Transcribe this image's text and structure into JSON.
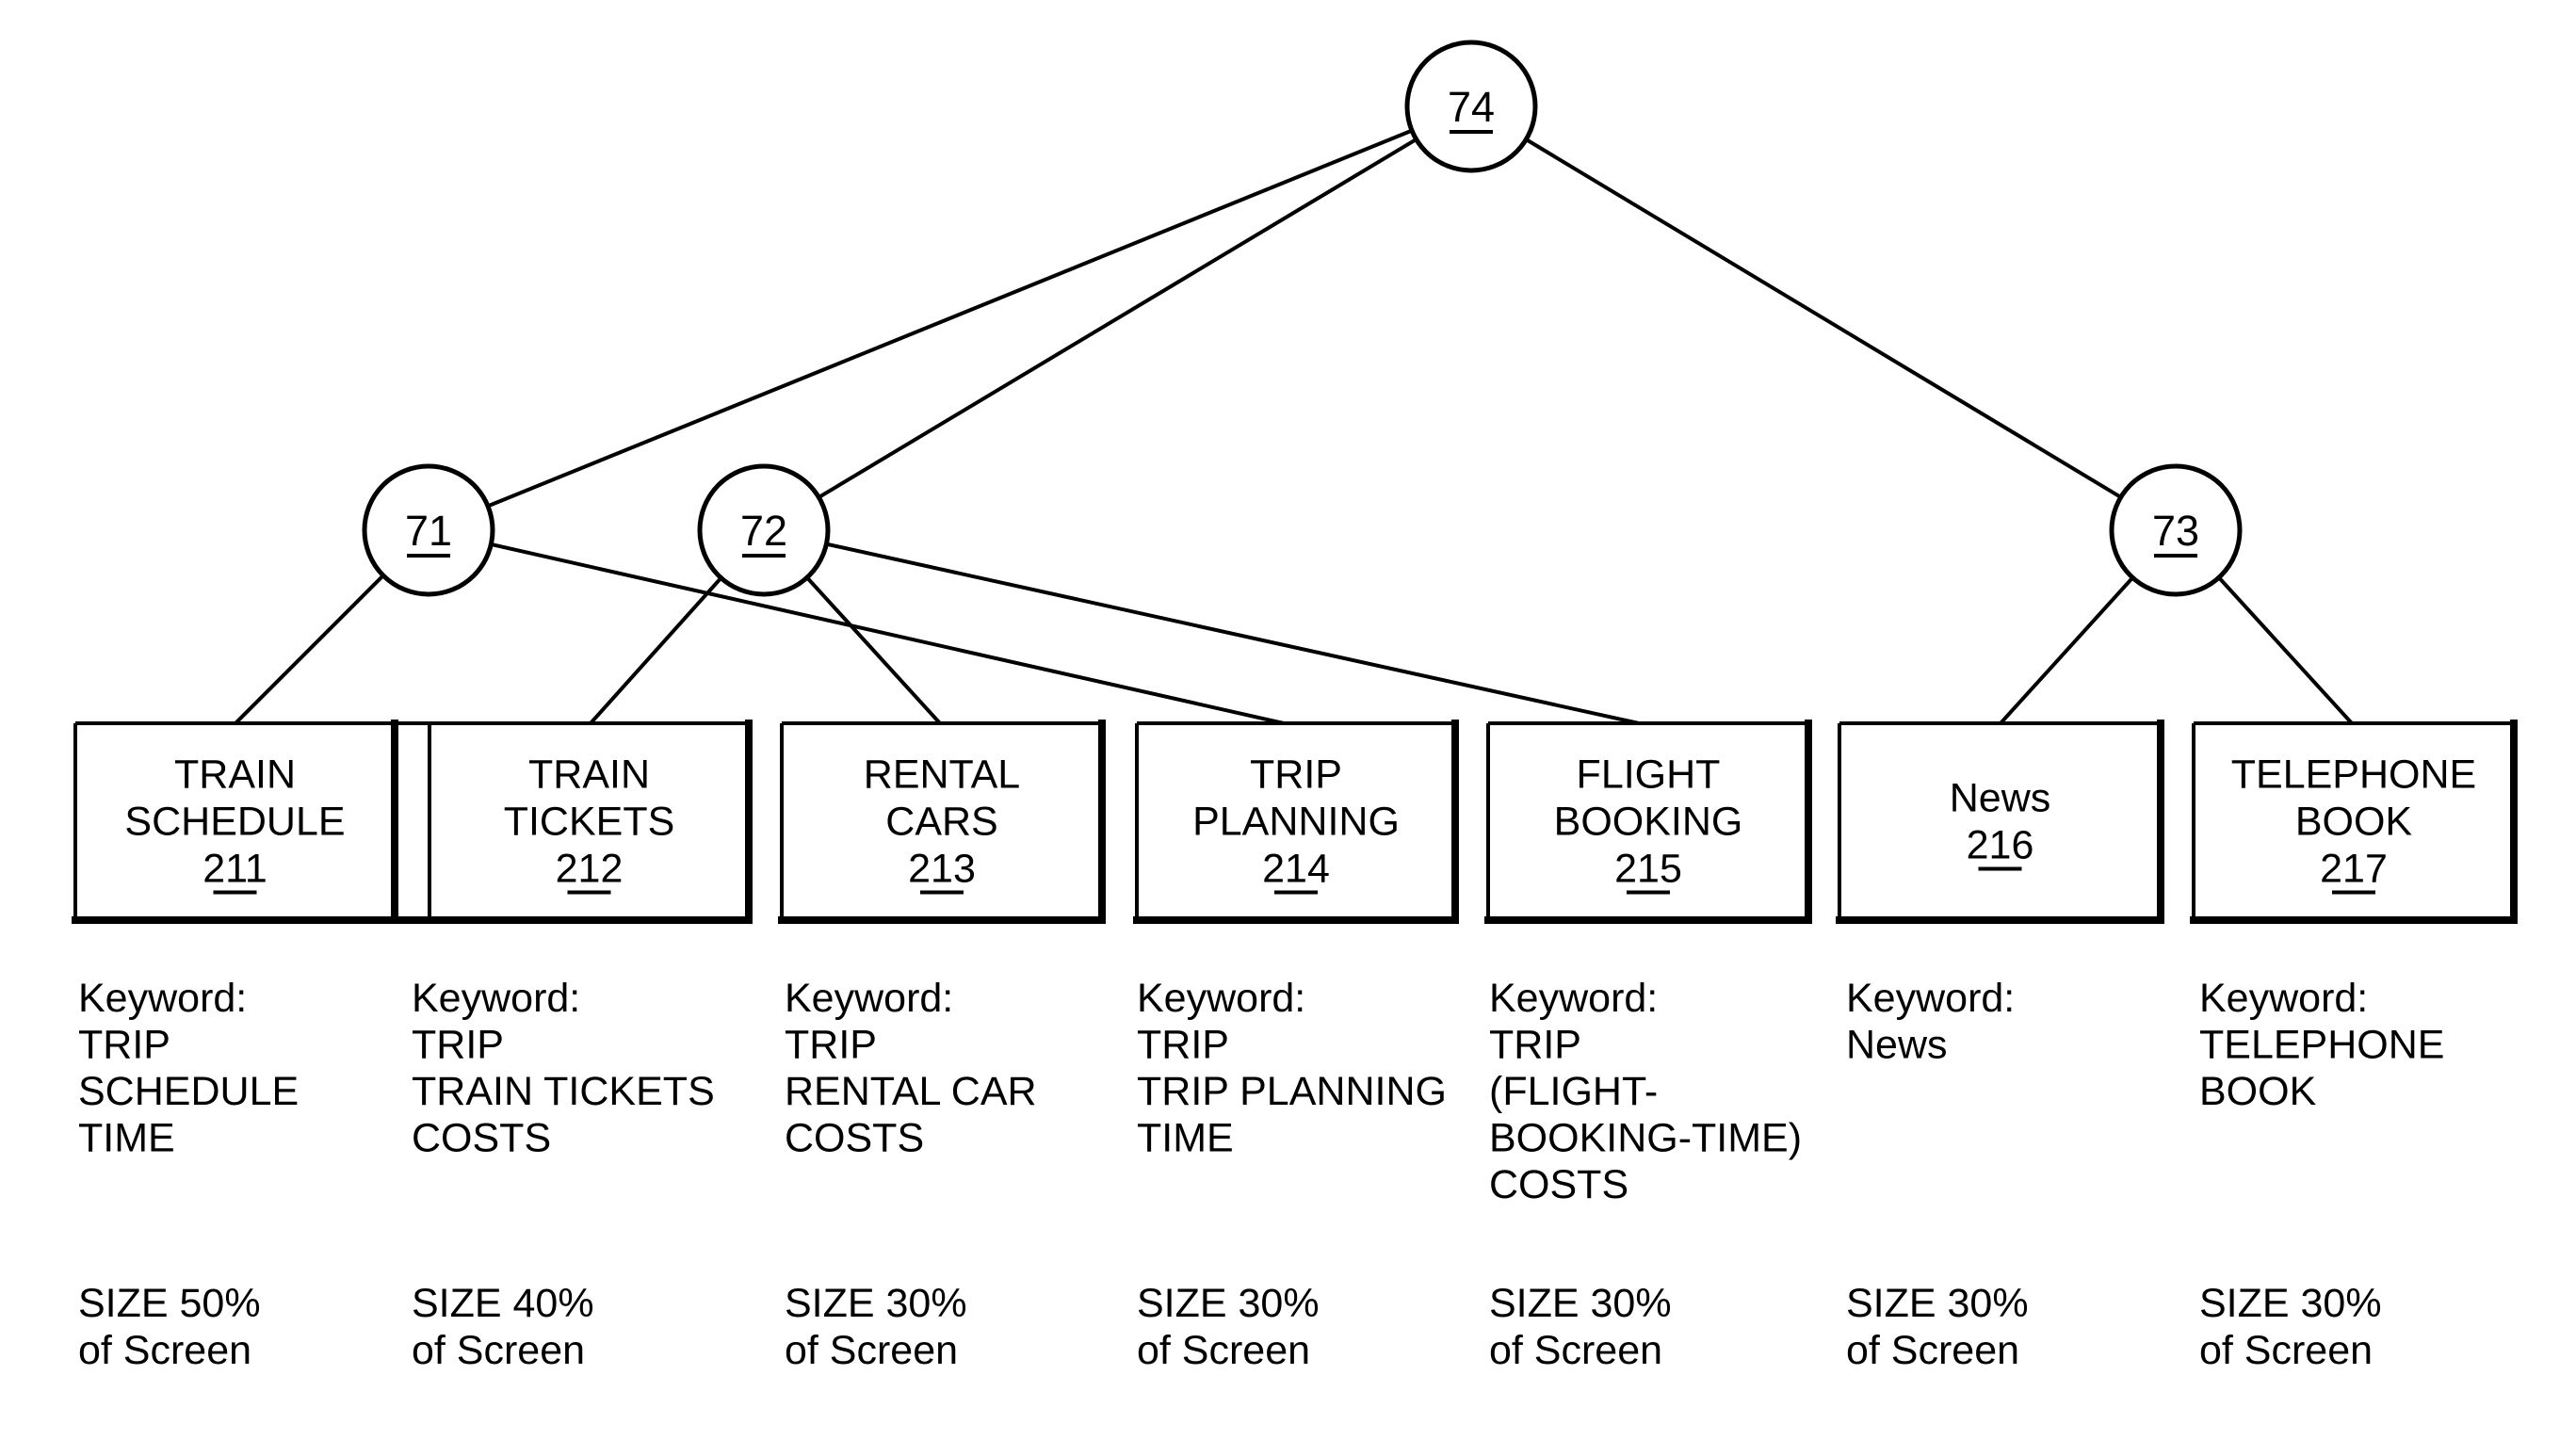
{
  "diagram": {
    "nodes": [
      {
        "id": "74",
        "label": "74",
        "level": "root"
      },
      {
        "id": "71",
        "label": "71",
        "level": "middle"
      },
      {
        "id": "72",
        "label": "72",
        "level": "middle"
      },
      {
        "id": "73",
        "label": "73",
        "level": "middle"
      }
    ],
    "edges": [
      {
        "from": "74",
        "to": "71"
      },
      {
        "from": "74",
        "to": "72"
      },
      {
        "from": "74",
        "to": "73"
      },
      {
        "from": "71",
        "to": "211"
      },
      {
        "from": "71",
        "to": "214"
      },
      {
        "from": "72",
        "to": "212"
      },
      {
        "from": "72",
        "to": "213"
      },
      {
        "from": "72",
        "to": "215"
      },
      {
        "from": "73",
        "to": "216"
      },
      {
        "from": "73",
        "to": "217"
      }
    ],
    "boxes": [
      {
        "id": "211",
        "lines": [
          "TRAIN",
          "SCHEDULE"
        ],
        "number": "211",
        "keyword_label": "Keyword:",
        "keywords": [
          "TRIP",
          "SCHEDULE",
          "TIME"
        ],
        "size_line1": "SIZE 50%",
        "size_line2": "of Screen"
      },
      {
        "id": "212",
        "lines": [
          "TRAIN",
          "TICKETS"
        ],
        "number": "212",
        "keyword_label": "Keyword:",
        "keywords": [
          "TRIP",
          "TRAIN TICKETS",
          "COSTS"
        ],
        "size_line1": "SIZE 40%",
        "size_line2": "of Screen"
      },
      {
        "id": "213",
        "lines": [
          "RENTAL",
          "CARS"
        ],
        "number": "213",
        "keyword_label": "Keyword:",
        "keywords": [
          "TRIP",
          "RENTAL CAR",
          "COSTS"
        ],
        "size_line1": "SIZE 30%",
        "size_line2": "of Screen"
      },
      {
        "id": "214",
        "lines": [
          "TRIP",
          "PLANNING"
        ],
        "number": "214",
        "keyword_label": "Keyword:",
        "keywords": [
          "TRIP",
          "TRIP PLANNING",
          "TIME"
        ],
        "size_line1": "SIZE 30%",
        "size_line2": "of Screen"
      },
      {
        "id": "215",
        "lines": [
          "FLIGHT",
          "BOOKING"
        ],
        "number": "215",
        "keyword_label": "Keyword:",
        "keywords": [
          "TRIP",
          "(FLIGHT-",
          "BOOKING-TIME)",
          "COSTS"
        ],
        "size_line1": "SIZE 30%",
        "size_line2": "of Screen"
      },
      {
        "id": "216",
        "lines": [
          "News"
        ],
        "number": "216",
        "keyword_label": "Keyword:",
        "keywords": [
          "News"
        ],
        "size_line1": "SIZE 30%",
        "size_line2": "of Screen"
      },
      {
        "id": "217",
        "lines": [
          "TELEPHONE",
          "BOOK"
        ],
        "number": "217",
        "keyword_label": "Keyword:",
        "keywords": [
          "TELEPHONE",
          "BOOK"
        ],
        "size_line1": "SIZE 30%",
        "size_line2": "of Screen"
      }
    ]
  }
}
